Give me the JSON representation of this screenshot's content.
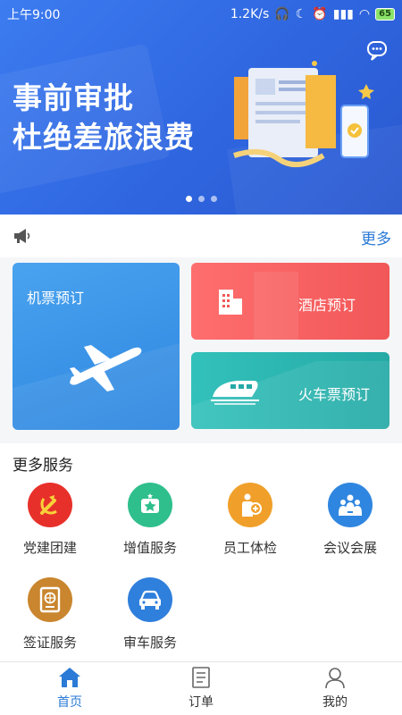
{
  "status_bar": {
    "time": "上午9:00",
    "speed": "1.2K/s",
    "battery": "65"
  },
  "banner": {
    "line1": "事前审批",
    "line2": "杜绝差旅浪费",
    "slides": 3,
    "active_slide": 1
  },
  "notice": {
    "more_label": "更多"
  },
  "booking": {
    "flight": "机票预订",
    "hotel": "酒店预订",
    "train": "火车票预订"
  },
  "services": {
    "title": "更多服务",
    "items": [
      {
        "label": "党建团建",
        "icon": "party-flag-icon",
        "color": "#e8302a"
      },
      {
        "label": "增值服务",
        "icon": "star-icon",
        "color": "#2fbf8c"
      },
      {
        "label": "员工体检",
        "icon": "health-checkup-icon",
        "color": "#f0a02a"
      },
      {
        "label": "会议会展",
        "icon": "meeting-icon",
        "color": "#2f86e0"
      },
      {
        "label": "签证服务",
        "icon": "passport-icon",
        "color": "#c9862e"
      },
      {
        "label": "审车服务",
        "icon": "car-icon",
        "color": "#2f7fdc"
      }
    ]
  },
  "tabbar": {
    "home": "首页",
    "orders": "订单",
    "mine": "我的",
    "active_color": "#2a7ad6"
  }
}
